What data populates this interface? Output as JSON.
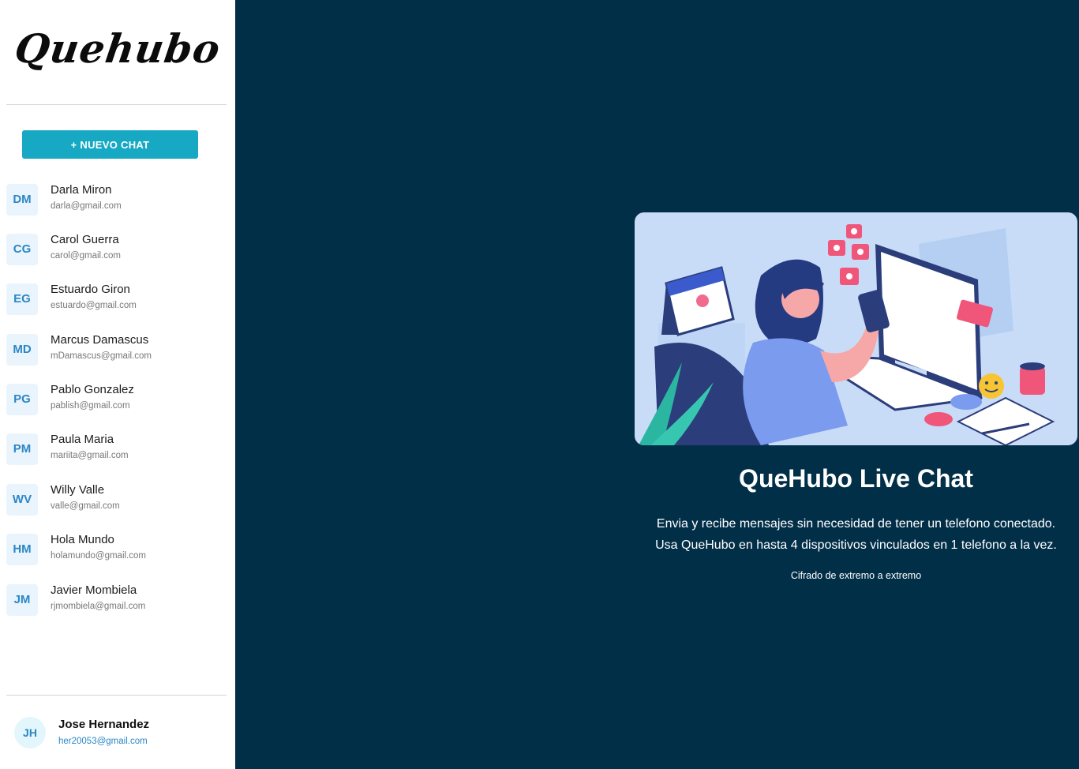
{
  "app": {
    "logo_text": "Quehubo"
  },
  "sidebar": {
    "new_chat_label": "+ NUEVO CHAT",
    "contacts": [
      {
        "initials": "DM",
        "name": "Darla Miron",
        "email": "darla@gmail.com"
      },
      {
        "initials": "CG",
        "name": "Carol Guerra",
        "email": "carol@gmail.com"
      },
      {
        "initials": "EG",
        "name": "Estuardo Giron",
        "email": "estuardo@gmail.com"
      },
      {
        "initials": "MD",
        "name": "Marcus Damascus",
        "email": "mDamascus@gmail.com"
      },
      {
        "initials": "PG",
        "name": "Pablo Gonzalez",
        "email": "pablish@gmail.com"
      },
      {
        "initials": "PM",
        "name": "Paula Maria",
        "email": "mariita@gmail.com"
      },
      {
        "initials": "WV",
        "name": "Willy Valle",
        "email": "valle@gmail.com"
      },
      {
        "initials": "HM",
        "name": "Hola Mundo",
        "email": "holamundo@gmail.com"
      },
      {
        "initials": "JM",
        "name": "Javier Mombiela",
        "email": "rjmombiela@gmail.com"
      }
    ],
    "current_user": {
      "initials": "JH",
      "name": "Jose Hernandez",
      "email": "her20053@gmail.com"
    }
  },
  "main": {
    "title": "QueHubo Live Chat",
    "description_line1": "Envia y recibe mensajes sin necesidad de tener un telefono conectado.",
    "description_line2": "Usa QueHubo en hasta 4 dispositivos vinculados en 1 telefono a la vez.",
    "encryption_note": "Cifrado de extremo a extremo"
  },
  "colors": {
    "background": "#022f48",
    "accent": "#17a9c3",
    "avatar_bg": "#eaf4fd",
    "avatar_text": "#2b87c6"
  }
}
